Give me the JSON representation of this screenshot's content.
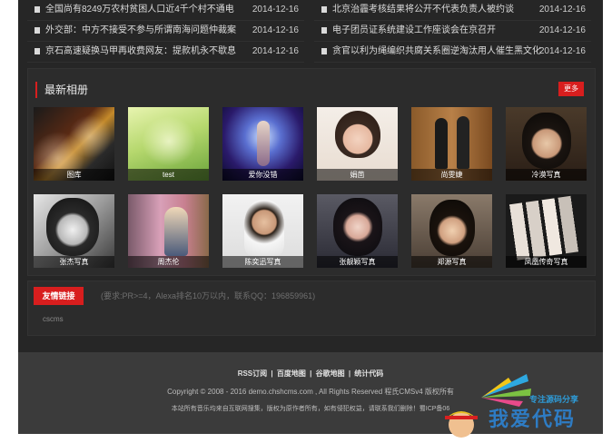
{
  "news": {
    "left": [
      {
        "title": "全国尚有8249万农村贫困人口近4千个村不通电",
        "date": "2014-12-16"
      },
      {
        "title": "外交部：中方不接受不参与所谓南海问题仲裁案",
        "date": "2014-12-16"
      },
      {
        "title": "京石高速疑换马甲再收费网友：提款机永不歇息",
        "date": "2014-12-16"
      }
    ],
    "right": [
      {
        "title": "北京治霾考核结果将公开不代表负责人被约谈",
        "date": "2014-12-16"
      },
      {
        "title": "电子团员证系统建设工作座谈会在京召开",
        "date": "2014-12-16"
      },
      {
        "title": "贪官以利为绳编织共腐关系圈逆淘汰用人催生黑文化",
        "date": "2014-12-16"
      }
    ]
  },
  "album": {
    "title": "最新相册",
    "more": "更多",
    "items": [
      {
        "caption": "图库",
        "icon": "photo-concert"
      },
      {
        "caption": "test",
        "icon": "photo-green"
      },
      {
        "caption": "爱你没错",
        "icon": "photo-dancer"
      },
      {
        "caption": "娟茴",
        "icon": "photo-woman"
      },
      {
        "caption": "尚雯婕",
        "icon": "photo-couple"
      },
      {
        "caption": "冷漠写真",
        "icon": "photo-man"
      },
      {
        "caption": "张杰写真",
        "icon": "photo-bw-man"
      },
      {
        "caption": "周杰伦",
        "icon": "photo-street"
      },
      {
        "caption": "陈奕迅写真",
        "icon": "photo-man-white"
      },
      {
        "caption": "张靓颖写真",
        "icon": "photo-woman-dark"
      },
      {
        "caption": "郑源写真",
        "icon": "photo-young-man"
      },
      {
        "caption": "凤凰传奇写真",
        "icon": "photo-collage"
      }
    ]
  },
  "links": {
    "button": "友情链接",
    "note": "(要求:PR>=4，Alexa排名10万以内，联系QQ：196859961)",
    "items": [
      "cscms"
    ]
  },
  "footer": {
    "nav": [
      "RSS订阅",
      "百度地图",
      "谷歌地图",
      "统计代码"
    ],
    "separator": "|",
    "copyright": "Copyright © 2008 - 2016 demo.chshcms.com , All Rights Reserved 程氏CMSv4 版权所有",
    "note": "本站所有音乐均来自互联网搜集，版权为原作者所有，如有侵犯权益，请联系我们删除！蜀ICP备06"
  },
  "watermark": {
    "subtitle": "专注源码分享",
    "main": "我爱代码"
  },
  "colors": {
    "accent": "#d81e1e",
    "background": "#262626",
    "panel": "#2c2c2c",
    "footer": "#3b3b3b"
  }
}
